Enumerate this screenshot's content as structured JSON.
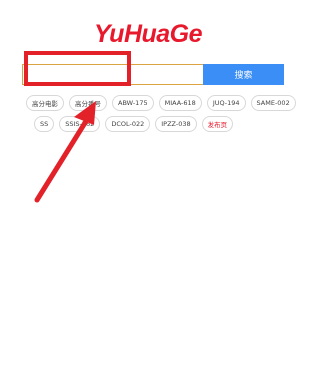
{
  "logo": {
    "text": "YuHuaGe"
  },
  "search": {
    "placeholder": "",
    "value": "",
    "button_label": "搜索"
  },
  "tags_row1": [
    "高分电影",
    "高分番号",
    "ABW-175",
    "MIAA-618",
    "JUQ-194",
    "SAME-002"
  ],
  "tags_row2": [
    "SSIS-262",
    "DCOL-022",
    "IPZZ-038"
  ],
  "tag_row2_first": "SS",
  "publish_label": "发布页",
  "colors": {
    "brand": "#e8192c",
    "button": "#3a8ef6",
    "annotation": "#e32129",
    "input_border": "#d9a441"
  }
}
